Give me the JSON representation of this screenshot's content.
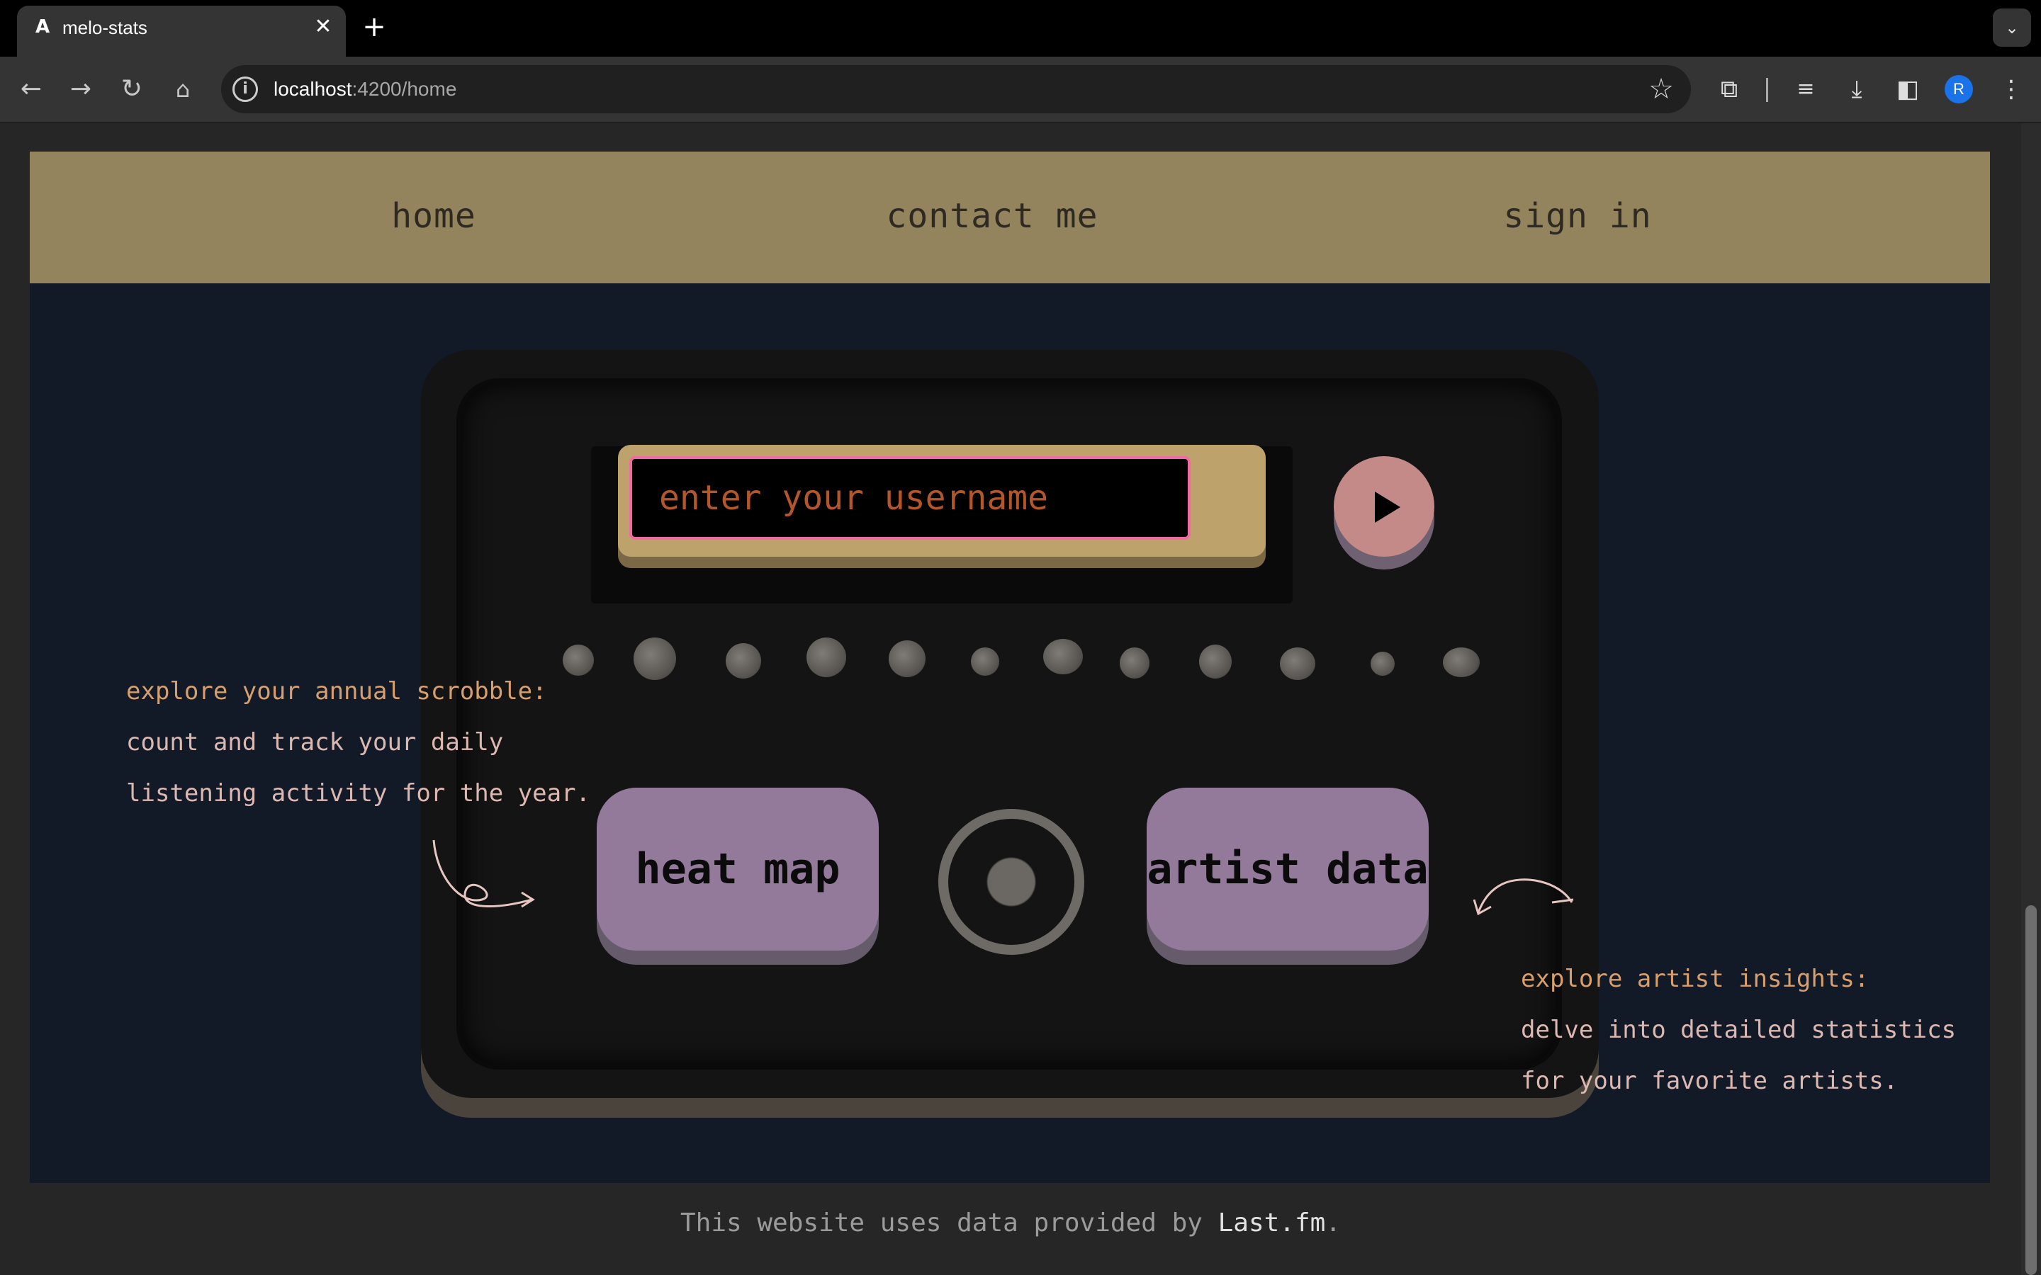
{
  "browser": {
    "tab_title": "melo-stats",
    "tab_favicon": "angular-logo-icon",
    "new_tab_label": "+",
    "url_host": "localhost",
    "url_path": ":4200/home",
    "profile_initial": "R"
  },
  "nav": {
    "home": "home",
    "contact": "contact me",
    "signin": "sign in"
  },
  "console": {
    "username_placeholder": "enter your username",
    "username_value": "",
    "heatmap_label": "heat map",
    "artist_label": "artist data"
  },
  "left_note": {
    "heading": "explore your annual scrobble:",
    "line1": "count and track your daily",
    "line2": "listening activity for the year."
  },
  "right_note": {
    "heading": "explore artist insights:",
    "line1": "delve into detailed statistics",
    "line2": "for your favorite artists."
  },
  "footer": {
    "text": "This website uses data provided by ",
    "link": "Last.fm",
    "suffix": "."
  },
  "colors": {
    "nav_bar": "#94845d",
    "hero_bg": "#121a27",
    "console_bg": "#141414",
    "input_border": "#f06aa3",
    "play_button": "#c48a88",
    "pad": "#93799a",
    "note_heading": "#d79f6e",
    "note_body": "#dcb8b2"
  }
}
